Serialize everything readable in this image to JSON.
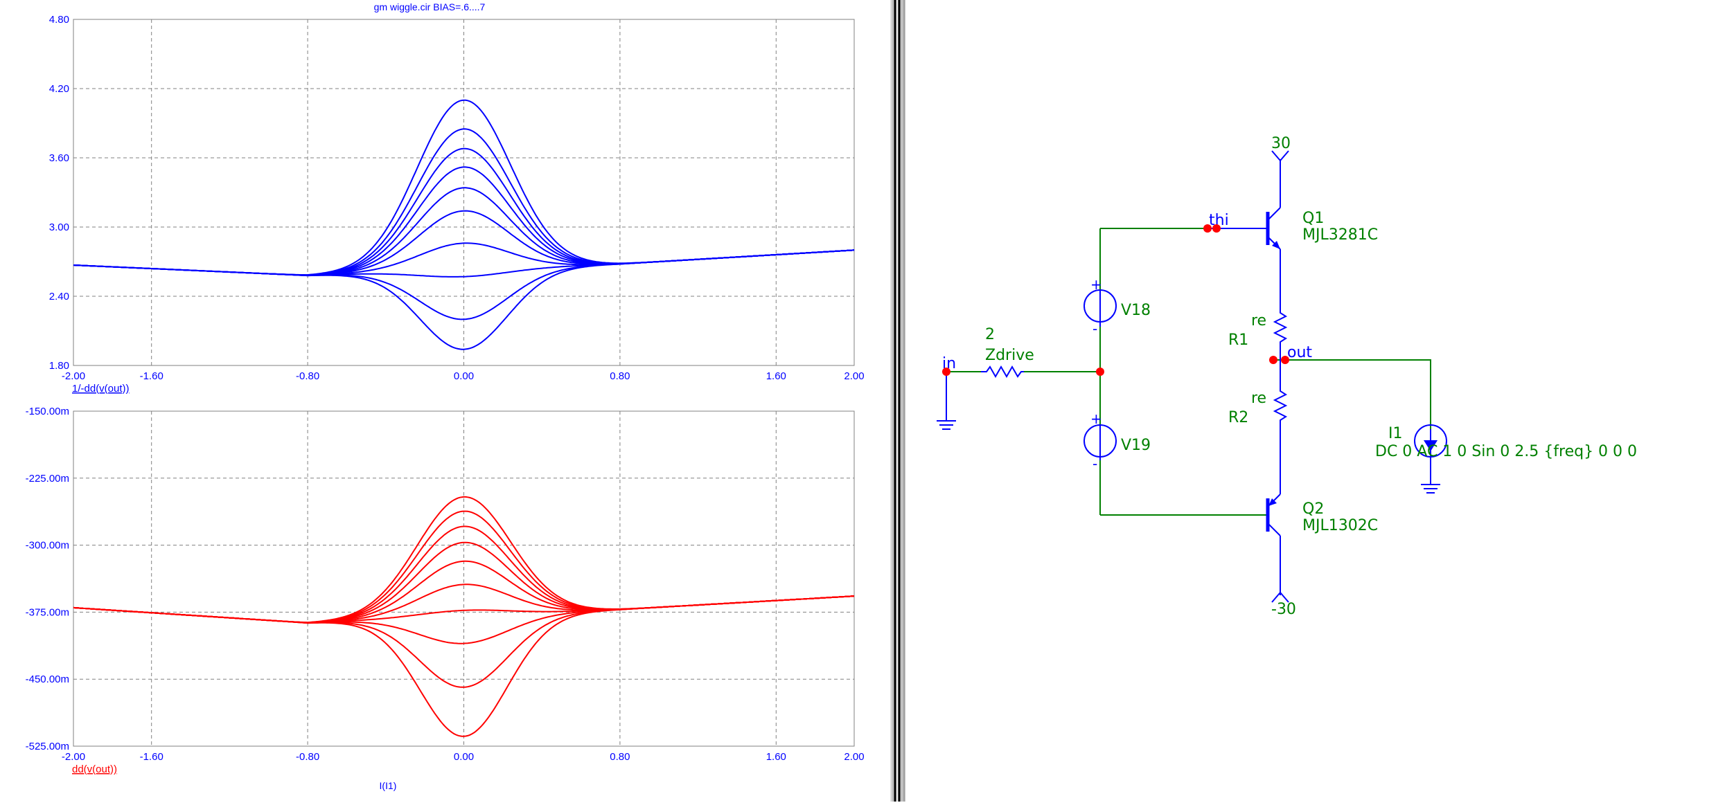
{
  "plot_title": "gm wiggle.cir BIAS=.6....7",
  "x_axis_label": "I(I1)",
  "colors": {
    "top_trace": "#0000ff",
    "bottom_trace": "#ff0000",
    "wire": "#008000",
    "part": "#0000ff",
    "node": "#ff0000",
    "grid": "#808080"
  },
  "chart_data": [
    {
      "type": "line",
      "title": "gm wiggle.cir BIAS=.6....7",
      "ylabel": "1/-dd(v(out))",
      "xlabel": "",
      "xlim": [
        -2.0,
        2.0
      ],
      "ylim": [
        1.8,
        4.8
      ],
      "x_ticks": [
        "-2.00",
        "-1.60",
        "-0.80",
        "0.00",
        "0.80",
        "1.60",
        "2.00"
      ],
      "y_ticks": [
        "1.80",
        "2.40",
        "3.00",
        "3.60",
        "4.20",
        "4.80"
      ],
      "grid": true,
      "color": "#0000ff",
      "series_peak_values_at_x0": [
        4.1,
        3.85,
        3.68,
        3.52,
        3.34,
        3.14,
        2.86,
        2.57,
        2.2,
        1.94
      ],
      "baseline_at_x_minus2": 2.67,
      "baseline_at_x_minus0.8": 2.58,
      "baseline_at_x_0.8": 2.68,
      "baseline_at_x_2": 2.8
    },
    {
      "type": "line",
      "title": "",
      "ylabel": "dd(v(out))",
      "xlabel": "I(I1)",
      "xlim": [
        -2.0,
        2.0
      ],
      "ylim": [
        -0.525,
        -0.15
      ],
      "x_ticks": [
        "-2.00",
        "-1.60",
        "-0.80",
        "0.00",
        "0.80",
        "1.60",
        "2.00"
      ],
      "y_ticks": [
        "-150.00m",
        "-225.00m",
        "-300.00m",
        "-375.00m",
        "-450.00m",
        "-525.00m"
      ],
      "grid": true,
      "color": "#ff0000",
      "series_peak_values_at_x0": [
        -0.246,
        -0.262,
        -0.279,
        -0.297,
        -0.318,
        -0.344,
        -0.373,
        -0.41,
        -0.459,
        -0.514
      ],
      "baseline_at_x_minus2": -0.37,
      "baseline_at_x_minus0.8": -0.387,
      "baseline_at_x_0.8": -0.372,
      "baseline_at_x_2": -0.357
    }
  ],
  "schematic": {
    "v_pos_label": "30",
    "v_neg_label": "-30",
    "q1_name": "Q1",
    "q1_model": "MJL3281C",
    "q2_name": "Q2",
    "q2_model": "MJL1302C",
    "r1_name": "R1",
    "r1_value": "re",
    "r2_name": "R2",
    "r2_value": "re",
    "v18_name": "V18",
    "v19_name": "V19",
    "plus_sign": "+",
    "minus_sign": "-",
    "zdrive_value": "2",
    "zdrive_name": "Zdrive",
    "net_in": "in",
    "net_thi": "thi",
    "net_out": "out",
    "i1_name": "I1",
    "i1_spec": "DC 0 AC 1 0 Sin 0 2.5 {freq} 0 0 0"
  }
}
